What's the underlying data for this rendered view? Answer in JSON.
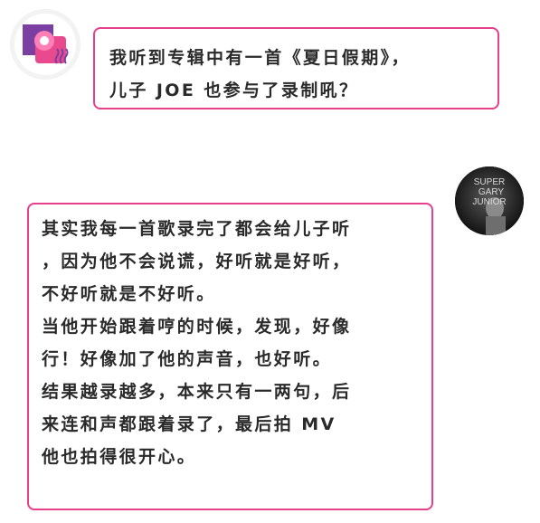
{
  "messages": [
    {
      "side": "left",
      "lines": [
        "我听到专辑中有一首《夏日假期》，",
        "儿子 JOE 也参与了录制吼？"
      ]
    },
    {
      "side": "right",
      "avatar_text": [
        "SUPER",
        "GARY",
        "JUNIOR"
      ],
      "lines": [
        "其实我每一首歌录完了都会给儿子听",
        "，因为他不会说谎，好听就是好听，",
        "不好听就是不好听。",
        "当他开始跟着哼的时候，发现，好像",
        "行！好像加了他的声音，也好听。",
        "结果越录越多，本来只有一两句，后",
        "来连和声都跟着录了，最后拍 MV",
        "他也拍得很开心。"
      ]
    }
  ],
  "colors": {
    "accent": "#e63f8c",
    "text": "#2a2a2a"
  }
}
